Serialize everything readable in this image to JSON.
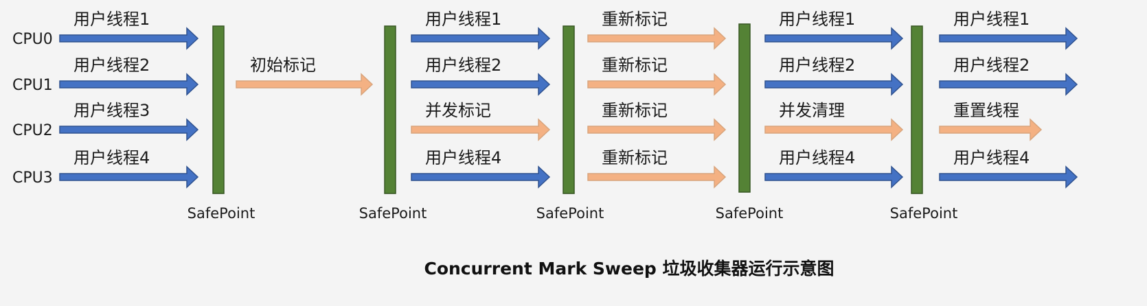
{
  "cpus": [
    "CPU0",
    "CPU1",
    "CPU2",
    "CPU3"
  ],
  "safepoint_label": "SafePoint",
  "title": "Concurrent Mark Sweep 垃圾收集器运行示意图",
  "colors": {
    "user_arrow_fill": "#4472c4",
    "user_arrow_stroke": "#2f528f",
    "gc_arrow_fill": "#f4b183",
    "gc_arrow_stroke": "#d8a47c",
    "safepoint_fill": "#548235",
    "safepoint_stroke": "#375623"
  },
  "phases": [
    {
      "lanes": [
        {
          "label": "用户线程1",
          "kind": "user"
        },
        {
          "label": "用户线程2",
          "kind": "user"
        },
        {
          "label": "用户线程3",
          "kind": "user"
        },
        {
          "label": "用户线程4",
          "kind": "user"
        }
      ]
    },
    {
      "lanes": [
        {
          "label": "初始标记",
          "kind": "gc"
        }
      ]
    },
    {
      "lanes": [
        {
          "label": "用户线程1",
          "kind": "user"
        },
        {
          "label": "用户线程2",
          "kind": "user"
        },
        {
          "label": "并发标记",
          "kind": "gc"
        },
        {
          "label": "用户线程4",
          "kind": "user"
        }
      ]
    },
    {
      "lanes": [
        {
          "label": "重新标记",
          "kind": "gc"
        },
        {
          "label": "重新标记",
          "kind": "gc"
        },
        {
          "label": "重新标记",
          "kind": "gc"
        },
        {
          "label": "重新标记",
          "kind": "gc"
        }
      ]
    },
    {
      "lanes": [
        {
          "label": "用户线程1",
          "kind": "user"
        },
        {
          "label": "用户线程2",
          "kind": "user"
        },
        {
          "label": "并发清理",
          "kind": "gc"
        },
        {
          "label": "用户线程4",
          "kind": "user"
        }
      ]
    },
    {
      "lanes": [
        {
          "label": "用户线程1",
          "kind": "user"
        },
        {
          "label": "用户线程2",
          "kind": "user"
        },
        {
          "label": "重置线程",
          "kind": "gc"
        },
        {
          "label": "用户线程4",
          "kind": "user"
        }
      ]
    }
  ]
}
